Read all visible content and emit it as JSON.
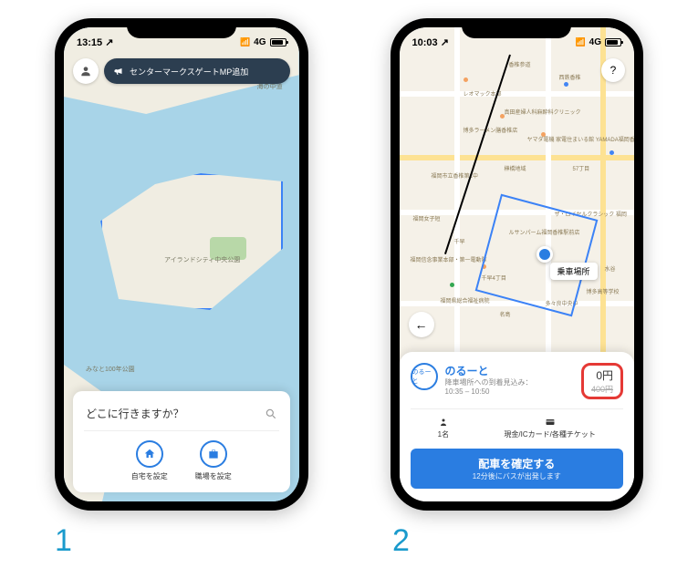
{
  "steps": {
    "one": "1",
    "two": "2"
  },
  "phone1": {
    "status": {
      "time": "13:15",
      "arrow": "↗",
      "net": "4G"
    },
    "announcement": "センターマークスゲートMP追加",
    "map_labels": {
      "sea": "海の中道",
      "island_park": "アイランドシティ中央公園",
      "minato": "みなと100年公園"
    },
    "search_placeholder": "どこに行きますか？",
    "shortcuts": {
      "home": "自宅を設定",
      "work": "職場を設定"
    }
  },
  "phone2": {
    "status": {
      "time": "10:03",
      "arrow": "↗",
      "net": "4G"
    },
    "help": "?",
    "back": "←",
    "map_labels": {
      "label1": "香椎参道",
      "label2": "西鉄香椎",
      "label3": "レオマック本部",
      "label4": "真田産婦人科麻酔科クリニック",
      "label5": "博多ラーメン膳香椎店",
      "label6": "ヤマダ電機 家電住まいる館 YAMADA福岡香椎本店",
      "label7": "福岡市立香椎第1中",
      "label8": "榊橋地域",
      "label9": "57丁目",
      "label10": "福岡女子短",
      "label11": "ザ・ロイヤルクラシック 福岡",
      "label12": "ルサンパーム福岡香椎駅前店",
      "label13": "千早",
      "label14": "福岡信念事業本部・第一電動隊",
      "label15": "千早4丁目",
      "label16": "水谷",
      "label17": "福岡県総合福祉病院",
      "label18": "名島",
      "label19": "多々良中央中",
      "label20": "博多高等学校"
    },
    "pickup_label": "乗車場所",
    "ride": {
      "logo_text": "のるーと",
      "name": "のるーと",
      "eta_label": "降車場所への到着見込み：",
      "eta_time": "10:35 – 10:50",
      "price": "0円",
      "price_original": "400円"
    },
    "options": {
      "passengers": "1名",
      "payment": "現金/ICカード/各種チケット"
    },
    "confirm": {
      "title": "配車を確定する",
      "subtitle": "12分後にバスが出発します"
    }
  }
}
